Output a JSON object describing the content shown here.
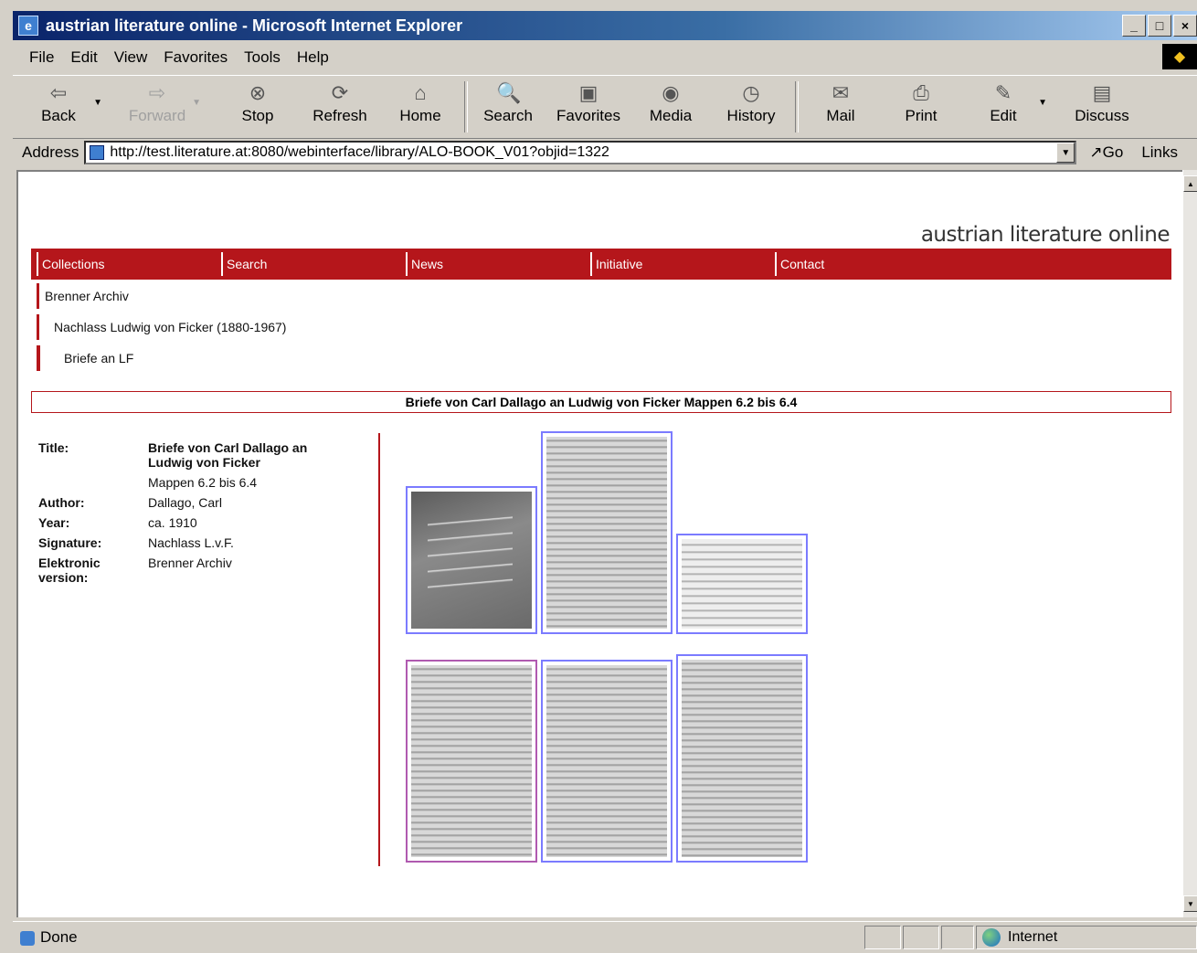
{
  "window": {
    "title": "austrian literature online - Microsoft Internet Explorer"
  },
  "menu": [
    "File",
    "Edit",
    "View",
    "Favorites",
    "Tools",
    "Help"
  ],
  "toolbar": {
    "back": "Back",
    "forward": "Forward",
    "stop": "Stop",
    "refresh": "Refresh",
    "home": "Home",
    "search": "Search",
    "favorites": "Favorites",
    "media": "Media",
    "history": "History",
    "mail": "Mail",
    "print": "Print",
    "edit": "Edit",
    "discuss": "Discuss"
  },
  "address": {
    "label": "Address",
    "url": "http://test.literature.at:8080/webinterface/library/ALO-BOOK_V01?objid=1322",
    "go": "Go",
    "links": "Links"
  },
  "page": {
    "site_title": "austrian literature online",
    "nav": [
      "Collections",
      "Search",
      "News",
      "Initiative",
      "Contact"
    ],
    "breadcrumbs": [
      "Brenner Archiv",
      "Nachlass Ludwig von Ficker (1880-1967)",
      "Briefe an LF"
    ],
    "book_heading": "Briefe von Carl Dallago an Ludwig von Ficker Mappen 6.2 bis 6.4",
    "metadata": {
      "title_label": "Title:",
      "title_value": "Briefe von Carl Dallago an Ludwig von Ficker",
      "title_sub": "Mappen 6.2 bis 6.4",
      "author_label": "Author:",
      "author_value": "Dallago, Carl",
      "year_label": "Year:",
      "year_value": "ca. 1910",
      "signature_label": "Signature:",
      "signature_value": "Nachlass L.v.F.",
      "elektronic_label": "Elektronic version:",
      "elektronic_value": "Brenner Archiv"
    }
  },
  "status": {
    "text": "Done",
    "zone": "Internet"
  }
}
